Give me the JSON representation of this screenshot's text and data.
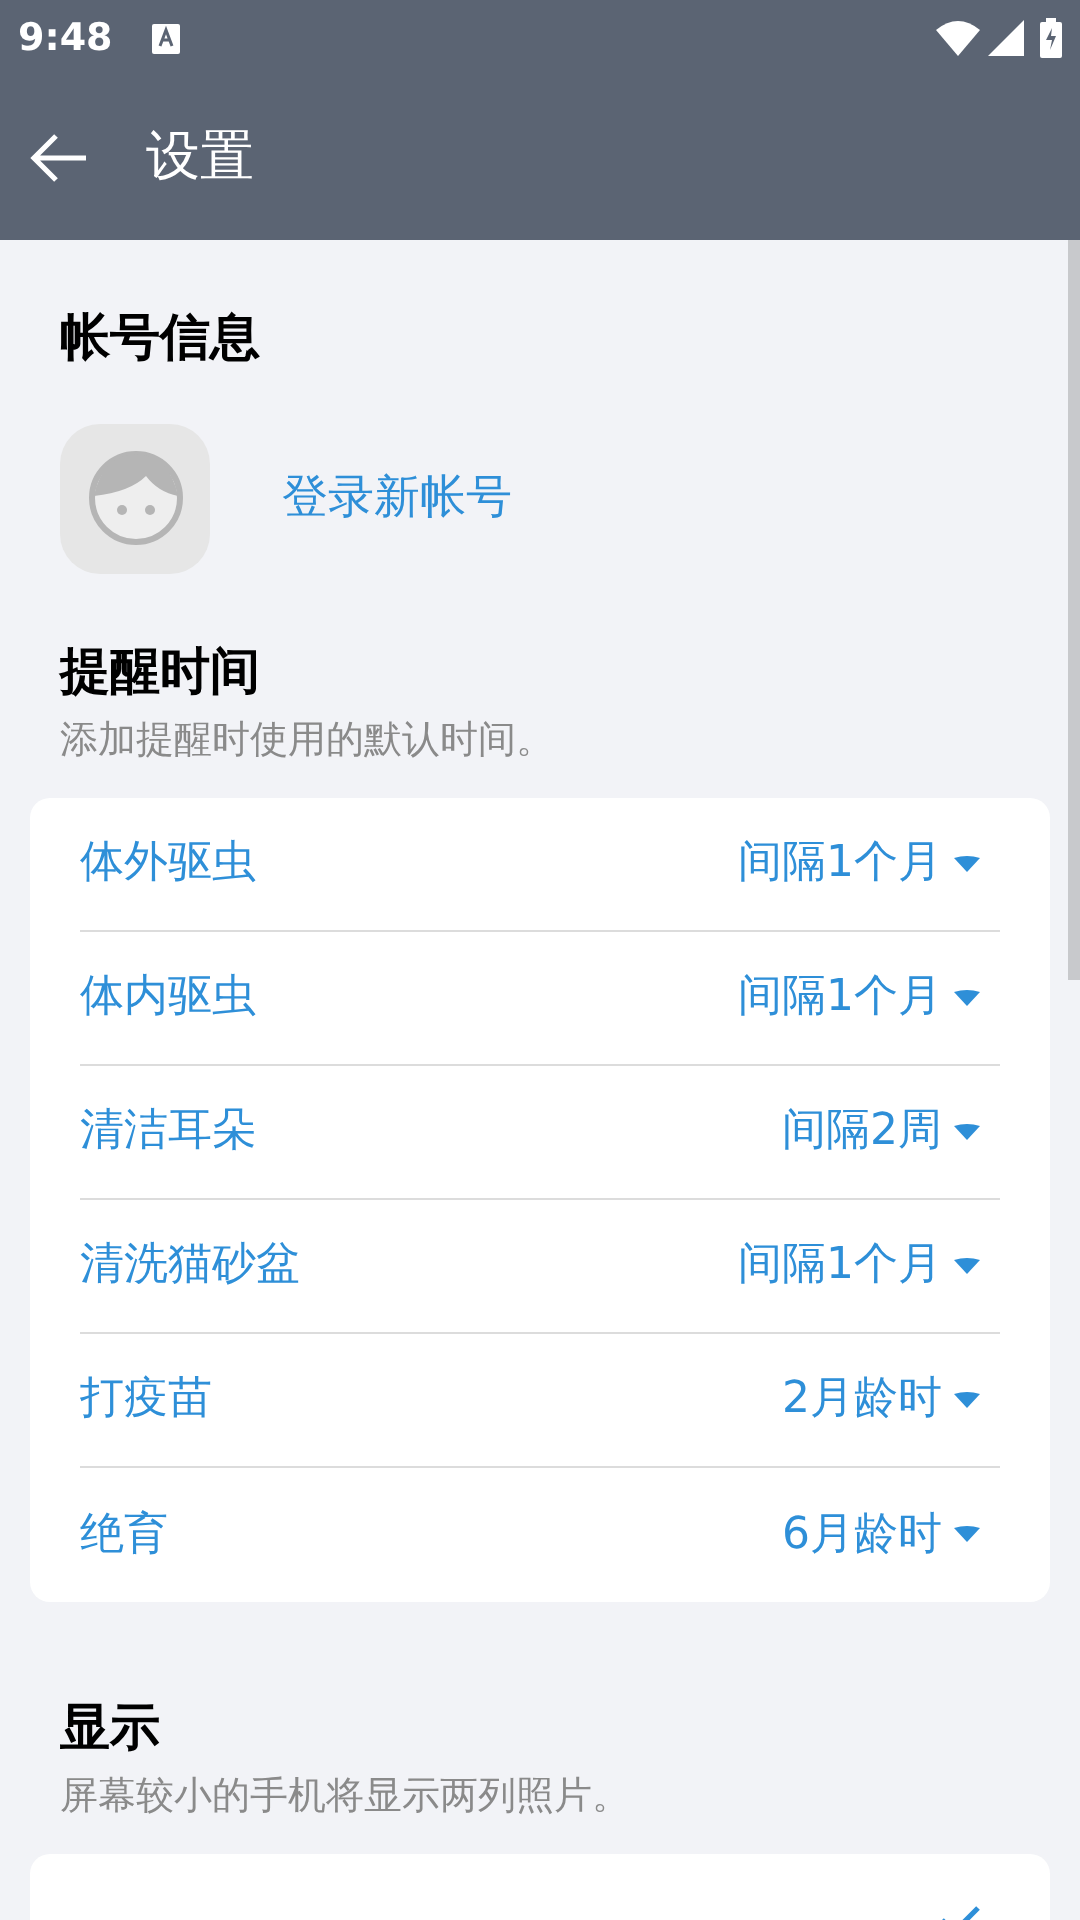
{
  "status_bar": {
    "time": "9:48"
  },
  "app_bar": {
    "title": "设置"
  },
  "account": {
    "heading": "帐号信息",
    "login_link": "登录新帐号"
  },
  "reminders": {
    "heading": "提醒时间",
    "subtitle": "添加提醒时使用的默认时间。",
    "rows": [
      {
        "label": "体外驱虫",
        "value": "间隔1个月"
      },
      {
        "label": "体内驱虫",
        "value": "间隔1个月"
      },
      {
        "label": "清洁耳朵",
        "value": "间隔2周"
      },
      {
        "label": "清洗猫砂盆",
        "value": "间隔1个月"
      },
      {
        "label": "打疫苗",
        "value": "2月龄时"
      },
      {
        "label": "绝育",
        "value": "6月龄时"
      }
    ]
  },
  "display": {
    "heading": "显示",
    "subtitle": "屏幕较小的手机将显示两列照片。",
    "rows": [
      {
        "checked": true
      }
    ]
  }
}
